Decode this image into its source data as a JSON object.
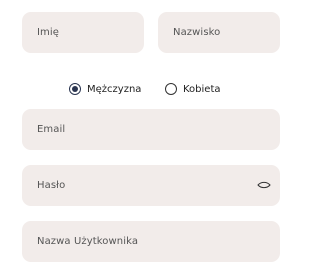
{
  "form": {
    "first_name": {
      "placeholder": "Imię"
    },
    "last_name": {
      "placeholder": "Nazwisko"
    },
    "gender": {
      "options": [
        {
          "label": "Mężczyzna",
          "selected": true
        },
        {
          "label": "Kobieta",
          "selected": false
        }
      ]
    },
    "email": {
      "placeholder": "Email"
    },
    "password": {
      "placeholder": "Hasło",
      "toggle_icon": "eye-icon"
    },
    "username": {
      "placeholder": "Nazwa Użytkownika"
    }
  },
  "colors": {
    "field_bg": "#f2ecea",
    "radio_selected": "#2a3550",
    "text": "#555555"
  }
}
